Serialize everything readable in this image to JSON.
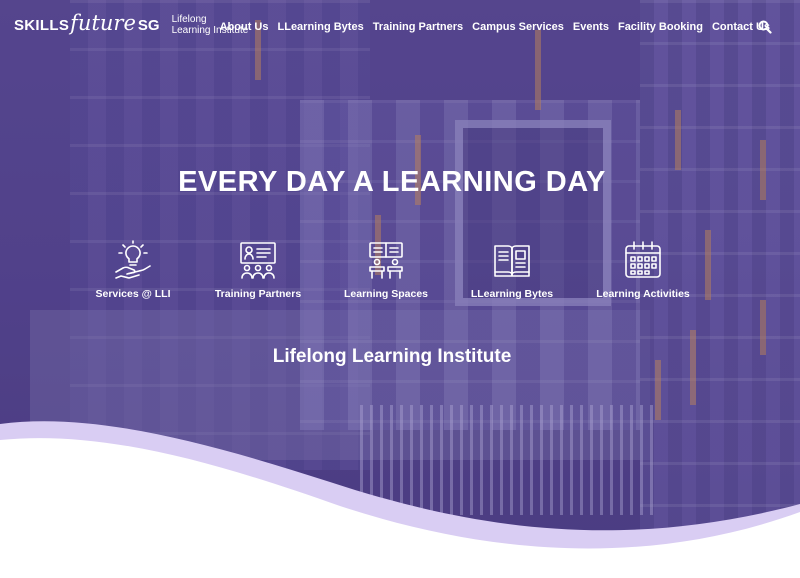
{
  "brand": {
    "skills": "SKILLS",
    "future": "future",
    "sg": "SG",
    "sub_line1": "Lifelong",
    "sub_line2": "Learning Institute"
  },
  "nav": {
    "items": [
      {
        "label": "About Us"
      },
      {
        "label": "LLearning Bytes"
      },
      {
        "label": "Training Partners"
      },
      {
        "label": "Campus Services"
      },
      {
        "label": "Events"
      },
      {
        "label": "Facility Booking"
      },
      {
        "label": "Contact Us"
      }
    ],
    "search_icon": "search-icon"
  },
  "hero": {
    "headline": "EVERY DAY A LEARNING DAY",
    "subtitle": "Lifelong Learning Institute"
  },
  "features": [
    {
      "label": "Services @ LLI",
      "icon": "lightbulb-hand-icon"
    },
    {
      "label": "Training Partners",
      "icon": "presentation-icon"
    },
    {
      "label": "Learning Spaces",
      "icon": "classroom-icon"
    },
    {
      "label": "LLearning Bytes",
      "icon": "book-icon"
    },
    {
      "label": "Learning Activities",
      "icon": "calendar-icon"
    }
  ],
  "colors": {
    "overlay": "#5a4b8e",
    "wave_light": "#d9cdf3",
    "wave_white": "#ffffff"
  }
}
